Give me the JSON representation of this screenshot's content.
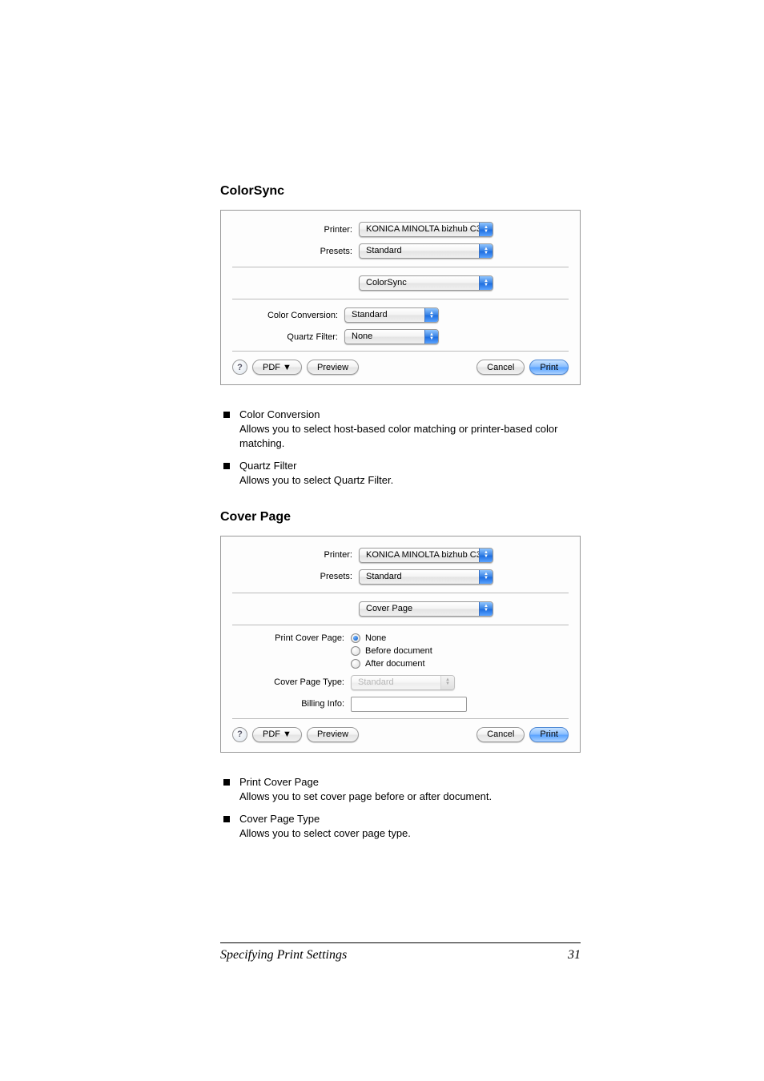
{
  "sections": {
    "colorsync": {
      "heading": "ColorSync"
    },
    "coverpage": {
      "heading": "Cover Page"
    }
  },
  "dialog1": {
    "labels": {
      "printer": "Printer:",
      "presets": "Presets:",
      "colorconv": "Color Conversion:",
      "quartz": "Quartz Filter:"
    },
    "values": {
      "printer": "KONICA MINOLTA bizhub C30...",
      "presets": "Standard",
      "pane": "ColorSync",
      "colorconv": "Standard",
      "quartz": "None"
    },
    "buttons": {
      "help": "?",
      "pdf": "PDF ▼",
      "preview": "Preview",
      "cancel": "Cancel",
      "print": "Print"
    }
  },
  "bullets1": [
    {
      "title": "Color Conversion",
      "desc": "Allows you to select host-based color matching or printer-based color matching."
    },
    {
      "title": "Quartz Filter",
      "desc": "Allows you to select Quartz Filter."
    }
  ],
  "dialog2": {
    "labels": {
      "printer": "Printer:",
      "presets": "Presets:",
      "printcover": "Print Cover Page:",
      "covertype": "Cover Page Type:",
      "billing": "Billing Info:"
    },
    "values": {
      "printer": "KONICA MINOLTA bizhub C30...",
      "presets": "Standard",
      "pane": "Cover Page",
      "covertype": "Standard"
    },
    "radios": {
      "none": "None",
      "before": "Before document",
      "after": "After document"
    },
    "buttons": {
      "help": "?",
      "pdf": "PDF ▼",
      "preview": "Preview",
      "cancel": "Cancel",
      "print": "Print"
    }
  },
  "bullets2": [
    {
      "title": "Print Cover Page",
      "desc": "Allows you to set cover page before or after document."
    },
    {
      "title": "Cover Page Type",
      "desc": "Allows you to select cover page type."
    }
  ],
  "footer": {
    "left": "Specifying Print Settings",
    "right": "31"
  }
}
